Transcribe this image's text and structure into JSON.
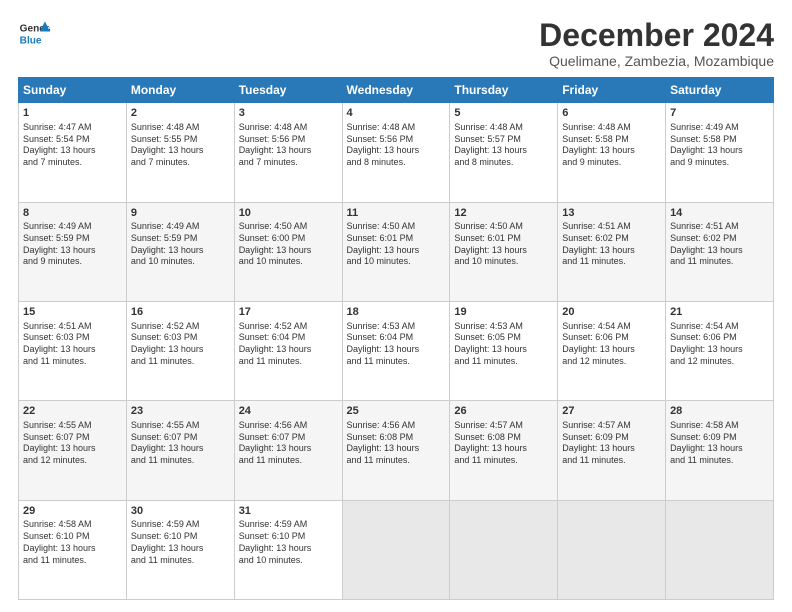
{
  "logo": {
    "line1": "General",
    "line2": "Blue"
  },
  "title": "December 2024",
  "subtitle": "Quelimane, Zambezia, Mozambique",
  "days_header": [
    "Sunday",
    "Monday",
    "Tuesday",
    "Wednesday",
    "Thursday",
    "Friday",
    "Saturday"
  ],
  "weeks": [
    [
      {
        "day": "1",
        "rise": "4:47 AM",
        "set": "5:54 PM",
        "daylight": "13 hours and 7 minutes."
      },
      {
        "day": "2",
        "rise": "4:48 AM",
        "set": "5:55 PM",
        "daylight": "13 hours and 7 minutes."
      },
      {
        "day": "3",
        "rise": "4:48 AM",
        "set": "5:56 PM",
        "daylight": "13 hours and 7 minutes."
      },
      {
        "day": "4",
        "rise": "4:48 AM",
        "set": "5:56 PM",
        "daylight": "13 hours and 8 minutes."
      },
      {
        "day": "5",
        "rise": "4:48 AM",
        "set": "5:57 PM",
        "daylight": "13 hours and 8 minutes."
      },
      {
        "day": "6",
        "rise": "4:48 AM",
        "set": "5:58 PM",
        "daylight": "13 hours and 9 minutes."
      },
      {
        "day": "7",
        "rise": "4:49 AM",
        "set": "5:58 PM",
        "daylight": "13 hours and 9 minutes."
      }
    ],
    [
      {
        "day": "8",
        "rise": "4:49 AM",
        "set": "5:59 PM",
        "daylight": "13 hours and 9 minutes."
      },
      {
        "day": "9",
        "rise": "4:49 AM",
        "set": "5:59 PM",
        "daylight": "13 hours and 10 minutes."
      },
      {
        "day": "10",
        "rise": "4:50 AM",
        "set": "6:00 PM",
        "daylight": "13 hours and 10 minutes."
      },
      {
        "day": "11",
        "rise": "4:50 AM",
        "set": "6:01 PM",
        "daylight": "13 hours and 10 minutes."
      },
      {
        "day": "12",
        "rise": "4:50 AM",
        "set": "6:01 PM",
        "daylight": "13 hours and 10 minutes."
      },
      {
        "day": "13",
        "rise": "4:51 AM",
        "set": "6:02 PM",
        "daylight": "13 hours and 11 minutes."
      },
      {
        "day": "14",
        "rise": "4:51 AM",
        "set": "6:02 PM",
        "daylight": "13 hours and 11 minutes."
      }
    ],
    [
      {
        "day": "15",
        "rise": "4:51 AM",
        "set": "6:03 PM",
        "daylight": "13 hours and 11 minutes."
      },
      {
        "day": "16",
        "rise": "4:52 AM",
        "set": "6:03 PM",
        "daylight": "13 hours and 11 minutes."
      },
      {
        "day": "17",
        "rise": "4:52 AM",
        "set": "6:04 PM",
        "daylight": "13 hours and 11 minutes."
      },
      {
        "day": "18",
        "rise": "4:53 AM",
        "set": "6:04 PM",
        "daylight": "13 hours and 11 minutes."
      },
      {
        "day": "19",
        "rise": "4:53 AM",
        "set": "6:05 PM",
        "daylight": "13 hours and 11 minutes."
      },
      {
        "day": "20",
        "rise": "4:54 AM",
        "set": "6:06 PM",
        "daylight": "13 hours and 12 minutes."
      },
      {
        "day": "21",
        "rise": "4:54 AM",
        "set": "6:06 PM",
        "daylight": "13 hours and 12 minutes."
      }
    ],
    [
      {
        "day": "22",
        "rise": "4:55 AM",
        "set": "6:07 PM",
        "daylight": "13 hours and 12 minutes."
      },
      {
        "day": "23",
        "rise": "4:55 AM",
        "set": "6:07 PM",
        "daylight": "13 hours and 11 minutes."
      },
      {
        "day": "24",
        "rise": "4:56 AM",
        "set": "6:07 PM",
        "daylight": "13 hours and 11 minutes."
      },
      {
        "day": "25",
        "rise": "4:56 AM",
        "set": "6:08 PM",
        "daylight": "13 hours and 11 minutes."
      },
      {
        "day": "26",
        "rise": "4:57 AM",
        "set": "6:08 PM",
        "daylight": "13 hours and 11 minutes."
      },
      {
        "day": "27",
        "rise": "4:57 AM",
        "set": "6:09 PM",
        "daylight": "13 hours and 11 minutes."
      },
      {
        "day": "28",
        "rise": "4:58 AM",
        "set": "6:09 PM",
        "daylight": "13 hours and 11 minutes."
      }
    ],
    [
      {
        "day": "29",
        "rise": "4:58 AM",
        "set": "6:10 PM",
        "daylight": "13 hours and 11 minutes."
      },
      {
        "day": "30",
        "rise": "4:59 AM",
        "set": "6:10 PM",
        "daylight": "13 hours and 11 minutes."
      },
      {
        "day": "31",
        "rise": "4:59 AM",
        "set": "6:10 PM",
        "daylight": "13 hours and 10 minutes."
      },
      null,
      null,
      null,
      null
    ]
  ],
  "labels": {
    "sunrise": "Sunrise:",
    "sunset": "Sunset:",
    "daylight": "Daylight:"
  }
}
